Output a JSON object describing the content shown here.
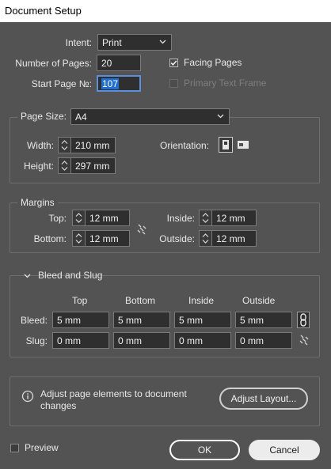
{
  "window": {
    "title": "Document Setup"
  },
  "general": {
    "intent_label": "Intent:",
    "intent_value": "Print",
    "pages_label": "Number of Pages:",
    "pages_value": "20",
    "start_label": "Start Page №:",
    "start_value": "107",
    "facing_label": "Facing Pages",
    "facing_checked": true,
    "primary_label": "Primary Text Frame",
    "primary_checked": false
  },
  "page_size": {
    "label": "Page Size:",
    "value": "A4",
    "width_label": "Width:",
    "width_value": "210 mm",
    "height_label": "Height:",
    "height_value": "297 mm",
    "orientation_label": "Orientation:"
  },
  "margins": {
    "legend": "Margins",
    "top_label": "Top:",
    "top_value": "12 mm",
    "bottom_label": "Bottom:",
    "bottom_value": "12 mm",
    "inside_label": "Inside:",
    "inside_value": "12 mm",
    "outside_label": "Outside:",
    "outside_value": "12 mm"
  },
  "bleed_slug": {
    "legend": "Bleed and Slug",
    "columns": [
      "Top",
      "Bottom",
      "Inside",
      "Outside"
    ],
    "bleed_label": "Bleed:",
    "bleed_values": [
      "5 mm",
      "5 mm",
      "5 mm",
      "5 mm"
    ],
    "slug_label": "Slug:",
    "slug_values": [
      "0 mm",
      "0 mm",
      "0 mm",
      "0 mm"
    ]
  },
  "adjust": {
    "message_line1": "Adjust page elements to document",
    "message_line2": "changes",
    "button": "Adjust Layout..."
  },
  "footer": {
    "preview_label": "Preview",
    "ok_label": "OK",
    "cancel_label": "Cancel"
  },
  "icons": {
    "dropdown": "chevron-down-icon",
    "spinner": "spinner-arrows-icon",
    "link": "chain-link-icon",
    "info": "info-icon",
    "portrait": "portrait-orientation-icon",
    "landscape": "landscape-orientation-icon",
    "collapse": "chevron-collapse-icon"
  },
  "colors": {
    "background": "#535353",
    "field": "#2f2f2f",
    "selection": "#1f6fd6",
    "focus_border": "#5b8fd9"
  }
}
